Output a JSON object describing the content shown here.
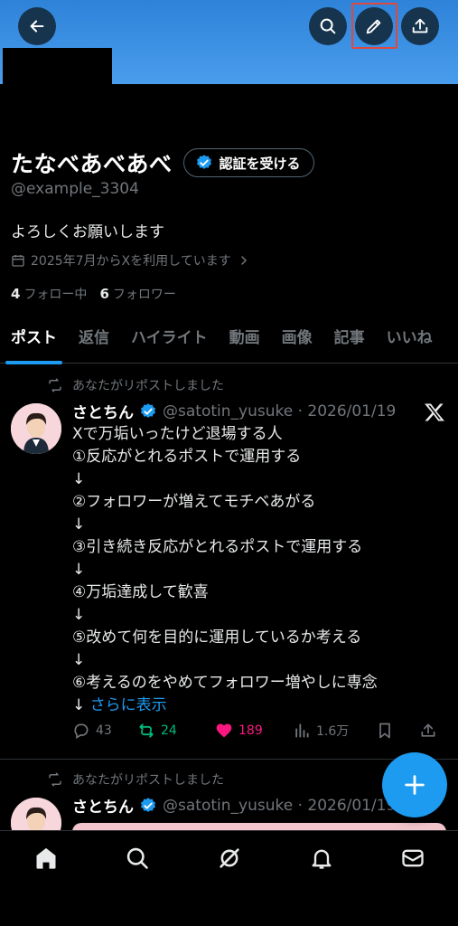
{
  "profile": {
    "display_name": "たなべあべあべ",
    "verify_label": "認証を受ける",
    "handle": "@example_3304",
    "bio": "よろしくお願いします",
    "joined": "2025年7月からXを利用しています",
    "following_count": "4",
    "following_label": "フォロー中",
    "followers_count": "6",
    "followers_label": "フォロワー"
  },
  "tabs": [
    "ポスト",
    "返信",
    "ハイライト",
    "動画",
    "画像",
    "記事",
    "いいね"
  ],
  "posts": [
    {
      "repost_label": "あなたがリポストしました",
      "author": "さとちん",
      "handle_date": "@satotin_yusuke · 2026/01/19",
      "lines": [
        "Xで万垢いったけど退場する人",
        "①反応がとれるポストで運用する",
        "↓",
        "②フォロワーが増えてモチベあがる",
        "↓",
        "③引き続き反応がとれるポストで運用する",
        "↓",
        "④万垢達成して歓喜",
        "↓",
        "⑤改めて何を目的に運用しているか考える",
        "↓",
        "⑥考えるのをやめてフォロワー増やしに専念"
      ],
      "more_prefix": "↓ ",
      "more_label": "さらに表示",
      "replies": "43",
      "reposts": "24",
      "likes": "189",
      "views": "1.6万"
    },
    {
      "repost_label": "あなたがリポストしました",
      "author": "さとちん",
      "handle_date": "@satotin_yusuke · 2026/01/19"
    }
  ],
  "colors": {
    "accent": "#1d9bf0",
    "like": "#f91880",
    "repost": "#00ba7c",
    "banner": "#4a9ded"
  },
  "icons": {
    "back": "arrow-left-icon",
    "search": "search-icon",
    "edit": "pencil-icon",
    "share": "upload-icon"
  }
}
